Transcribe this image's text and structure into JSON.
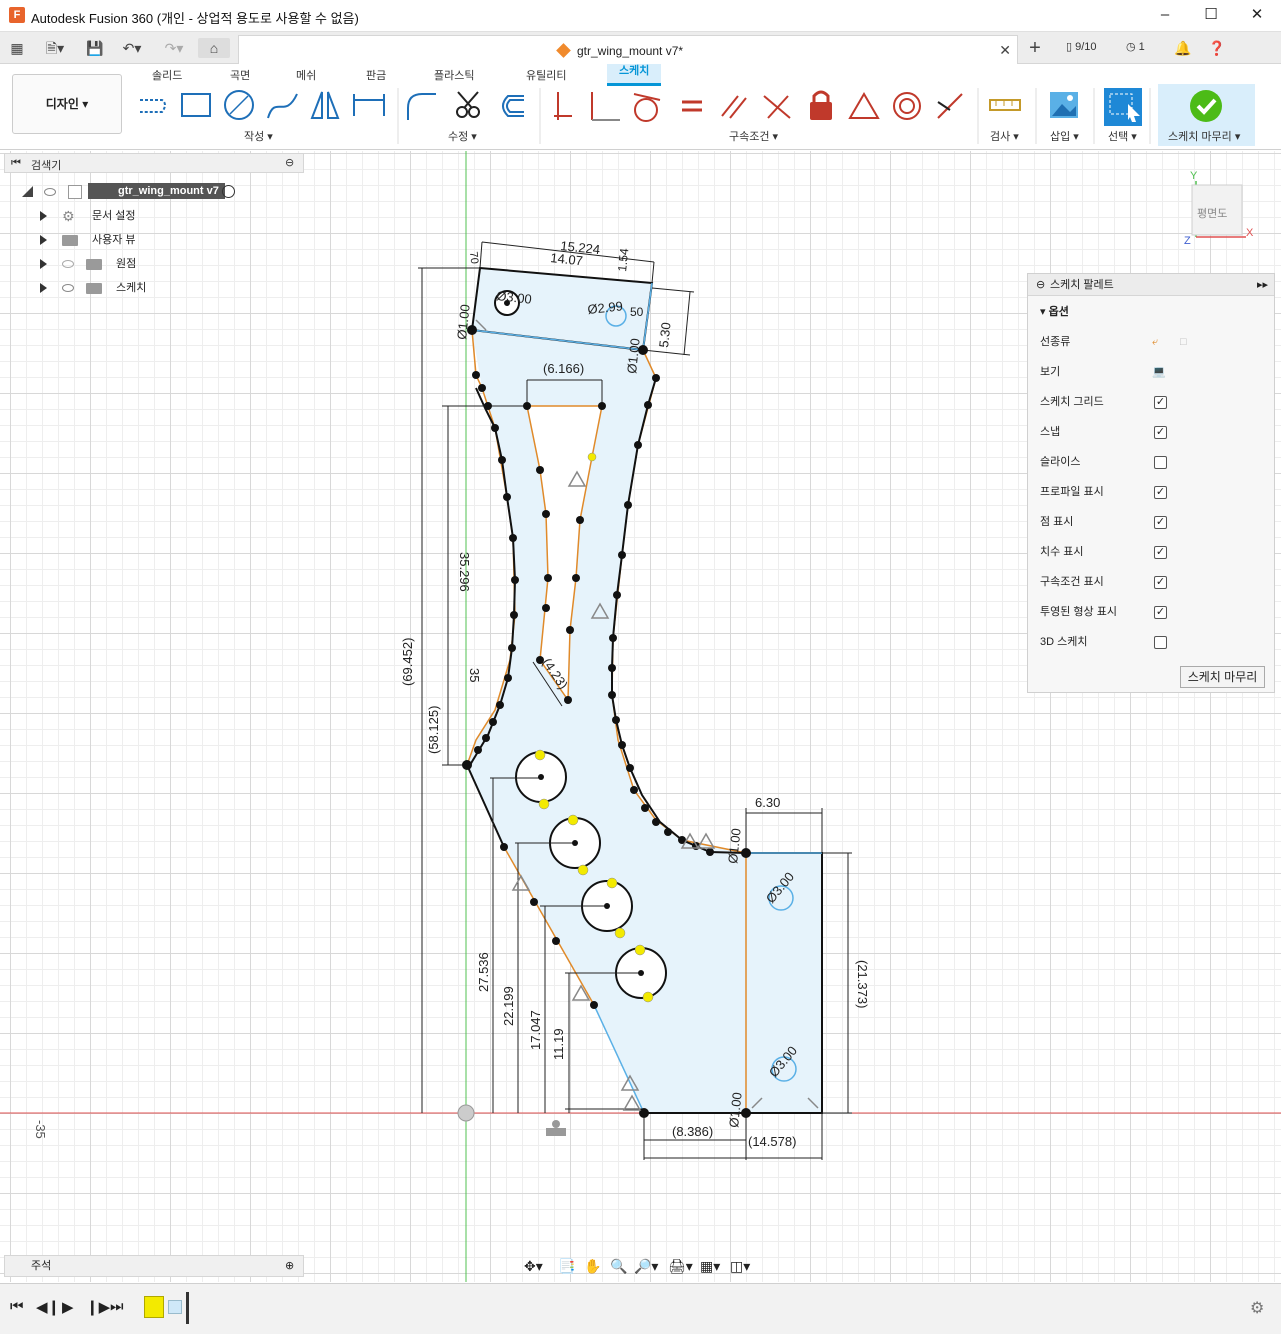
{
  "window": {
    "title": "Autodesk Fusion 360 (개인 - 상업적 용도로 사용할 수 없음)",
    "app_icon": "F"
  },
  "document": {
    "tab_title": "gtr_wing_mount v7*",
    "jobs": "9/10",
    "notifications_count": "1"
  },
  "workspace": {
    "label": "디자인 ▾"
  },
  "ribbon": {
    "tabs": [
      "솔리드",
      "곡면",
      "메쉬",
      "판금",
      "플라스틱",
      "유틸리티",
      "스케치"
    ],
    "active_tab": "스케치",
    "groups": {
      "create": "작성 ▾",
      "modify": "수정 ▾",
      "constraints": "구속조건 ▾",
      "inspect": "검사 ▾",
      "insert": "삽입 ▾",
      "select": "선택 ▾",
      "finish": "스케치 마무리 ▾"
    }
  },
  "browser": {
    "title": "검색기",
    "root": "gtr_wing_mount v7",
    "items": [
      {
        "label": "문서 설정",
        "icon": "gear-icon"
      },
      {
        "label": "사용자 뷰",
        "icon": "folder-icon"
      },
      {
        "label": "원점",
        "icon": "folder-icon"
      },
      {
        "label": "스케치",
        "icon": "folder-icon"
      }
    ]
  },
  "viewcube": {
    "face": "평면도",
    "axes": {
      "x": "X",
      "y": "Y",
      "z": "Z"
    }
  },
  "palette": {
    "title": "스케치 팔레트",
    "section": "옵션",
    "rows": [
      {
        "label": "선종류",
        "type": "icons"
      },
      {
        "label": "보기",
        "type": "icon"
      },
      {
        "label": "스케치 그리드",
        "checked": true
      },
      {
        "label": "스냅",
        "checked": true
      },
      {
        "label": "슬라이스",
        "checked": false
      },
      {
        "label": "프로파일 표시",
        "checked": true
      },
      {
        "label": "점 표시",
        "checked": true
      },
      {
        "label": "치수 표시",
        "checked": true
      },
      {
        "label": "구속조건 표시",
        "checked": true
      },
      {
        "label": "투영된 형상 표시",
        "checked": true
      },
      {
        "label": "3D 스케치",
        "checked": false
      }
    ],
    "finish_button": "스케치 마무리"
  },
  "notes": {
    "label": "주석"
  },
  "canvas": {
    "axis_label": "-35"
  },
  "dimensions": {
    "top_width_1": "15.224",
    "top_width_2": "14.07",
    "top_angle": "70",
    "top_small": "1.54",
    "top_height": "5.30",
    "dia_top_left": "Ø3.00",
    "dia_top_right": "Ø2.99",
    "dia_top_right_2": "50",
    "dia_1_top_left": "Ø1.00",
    "dia_1_top_right": "Ø1.00",
    "inner_width": "(6.166)",
    "inner_diag": "(4.23)",
    "height_35296": "35.296",
    "height_35": "35",
    "height_69452": "(69.452)",
    "height_58125": "(58.125)",
    "right_width": "6.30",
    "dia_1_right": "Ø1.00",
    "dia_3_right_top": "Ø3.00",
    "dia_3_right_bottom": "Ø3.00",
    "dia_1_bottom": "Ø1.00",
    "right_height": "(21.373)",
    "h_27536": "27.536",
    "h_22199": "22.199",
    "h_17047": "17.047",
    "h_1119": "11.19",
    "bottom_1": "(8.386)",
    "bottom_2": "(14.578)"
  },
  "colors": {
    "accent": "#0696d7",
    "profile_fill": "#e6f3fb",
    "sketch_orange": "#e08a2a",
    "point_yellow": "#f3ea00",
    "axis_red": "#e05050",
    "axis_green": "#50c050"
  }
}
